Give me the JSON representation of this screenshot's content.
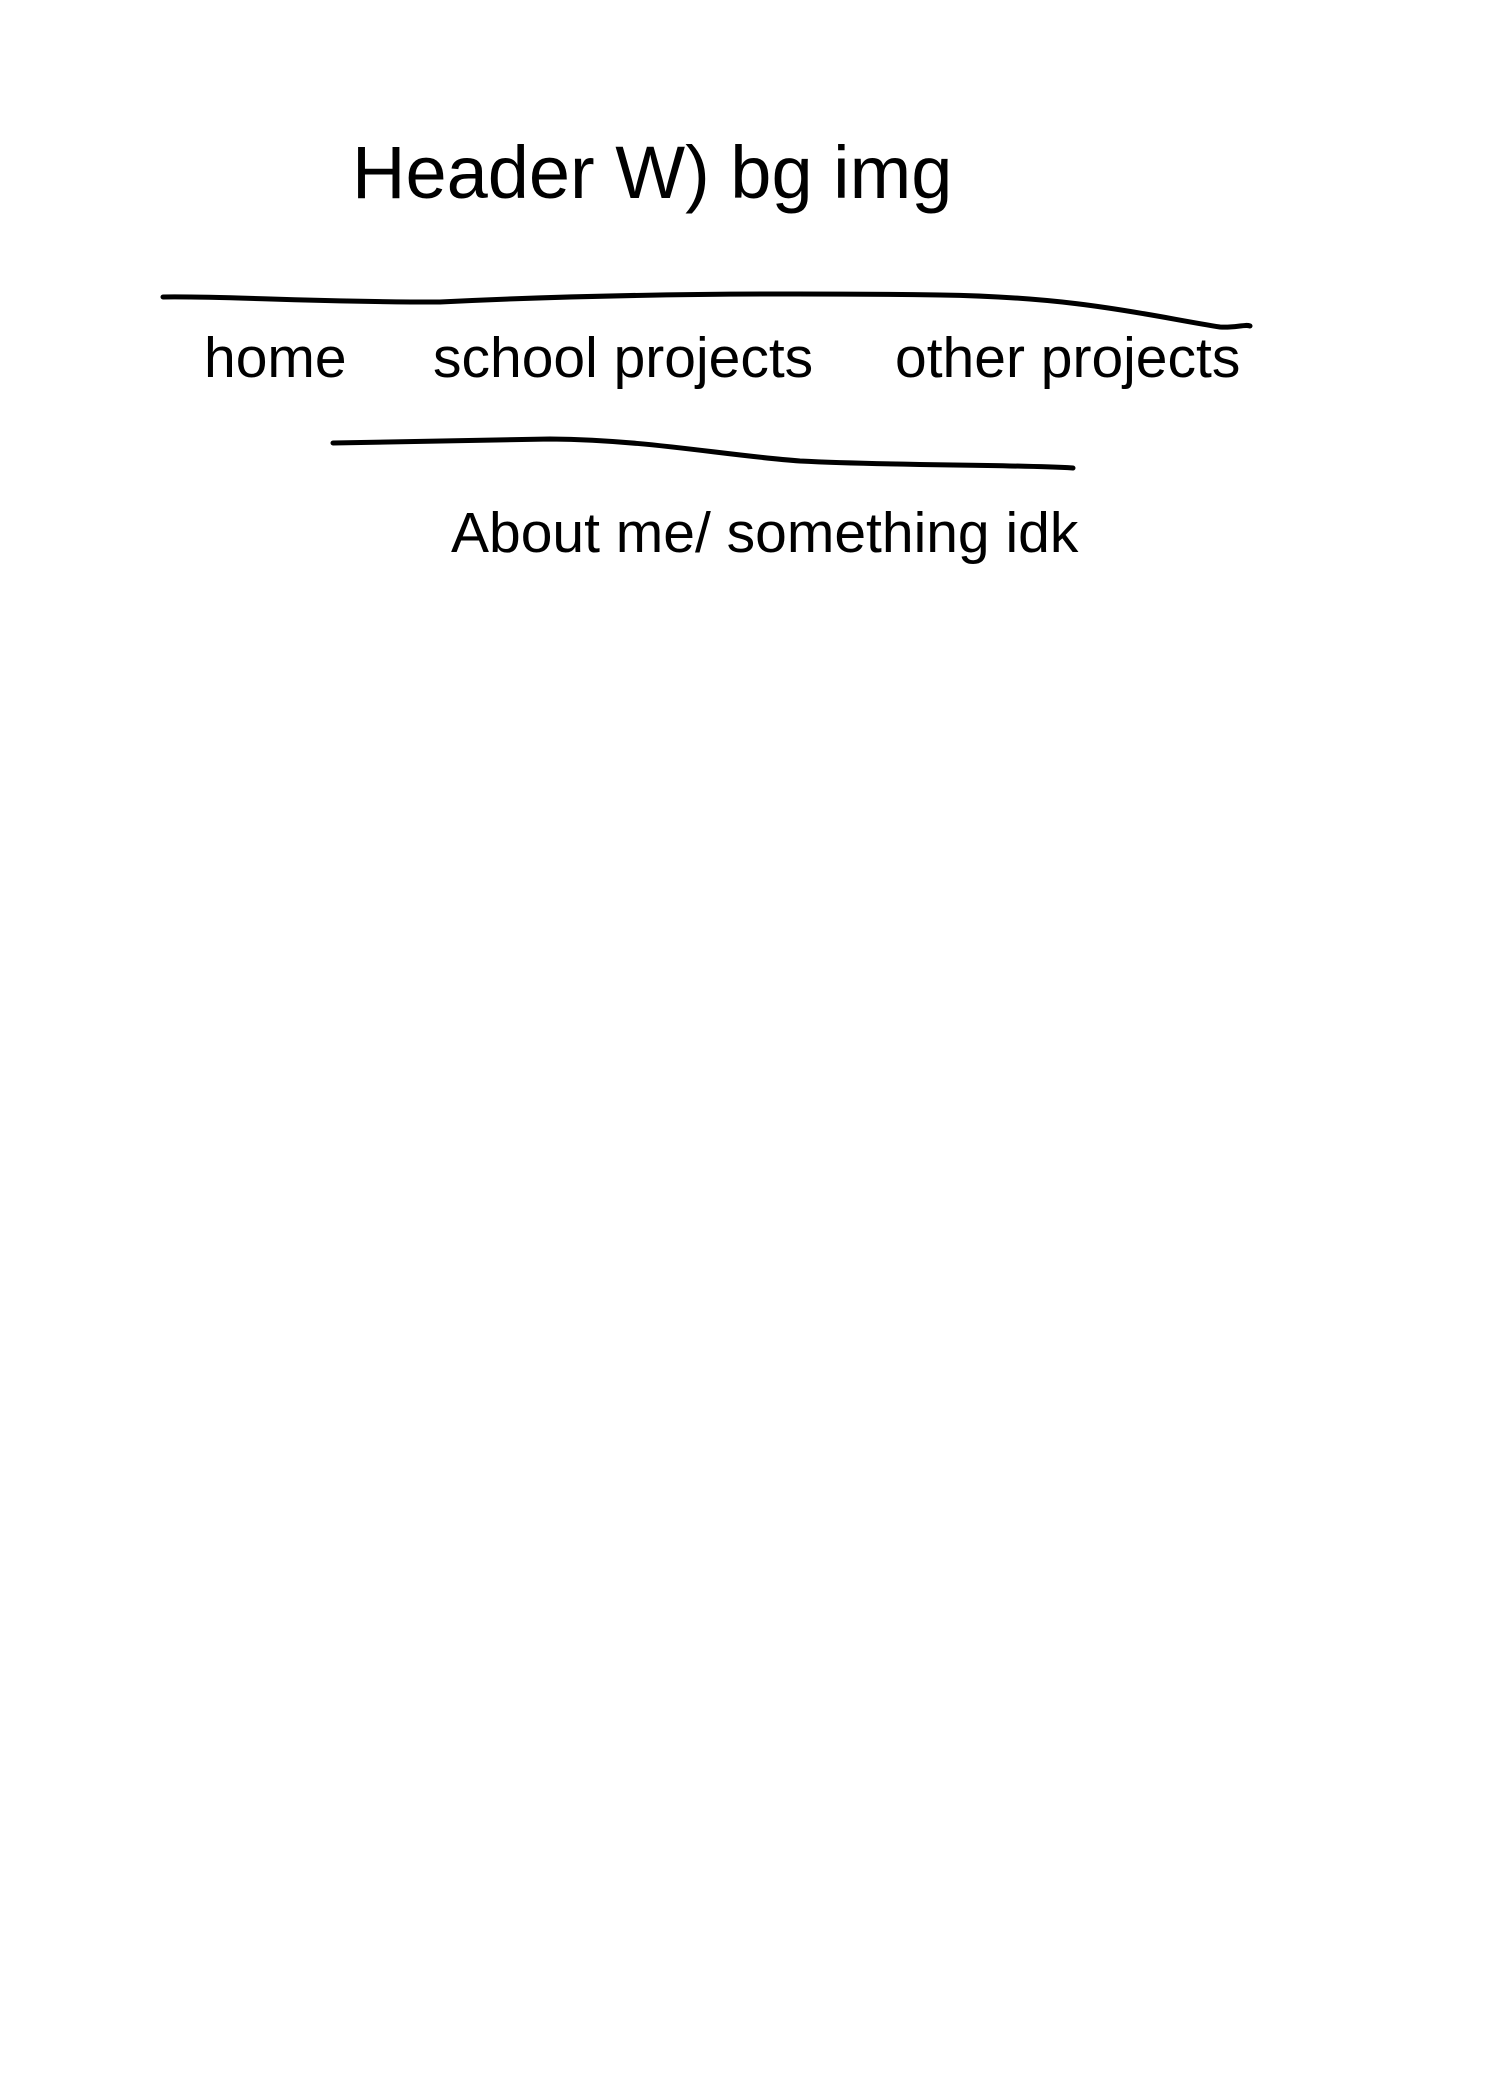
{
  "header": {
    "title": "Header W) bg img"
  },
  "nav": {
    "items": [
      {
        "label": "home"
      },
      {
        "label": "school projects"
      },
      {
        "label": "other projects"
      }
    ]
  },
  "about": {
    "text": "About me/ something idk"
  },
  "colors": {
    "ink": "#000000",
    "paper": "#ffffff"
  }
}
